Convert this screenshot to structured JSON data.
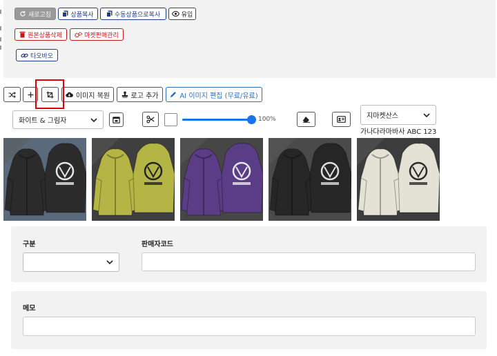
{
  "top_buttons": {
    "refresh": "새로고침",
    "copy_product": "상품복사",
    "manual_copy": "수동상품으로복사",
    "inflow": "유입",
    "delete_original": "원본상품삭제",
    "market_manage": "마켓판매관리",
    "taobao": "타오바오"
  },
  "toolbar": {
    "restore_image": "이미지 복원",
    "add_logo": "로고 추가",
    "ai_edit": "AI 이미지 편집 (무료/유료)"
  },
  "controls": {
    "background_select": "화이트 & 그림자",
    "opacity_percent": "100%",
    "opacity_value": 100,
    "font_select": "지마켓산스",
    "font_preview": "가나다라마바사 ABC 123"
  },
  "thumbnails": [
    {
      "name": "black-jacket-street",
      "body": "#2b2b2b",
      "bg": "#5a6a7a",
      "print": "#e8e8e8"
    },
    {
      "name": "olive-jacket",
      "body": "#b5b545",
      "bg": "#3f3f3f",
      "print": "#222222"
    },
    {
      "name": "purple-jacket",
      "body": "#5b3c86",
      "bg": "#464646",
      "print": "#e8e8e8"
    },
    {
      "name": "black-jacket",
      "body": "#262626",
      "bg": "#4a4a4a",
      "print": "#e0e0e0"
    },
    {
      "name": "cream-jacket",
      "body": "#e4e2d4",
      "bg": "#3c3c3c",
      "print": "#2a2a2a"
    }
  ],
  "form": {
    "category_label": "구분",
    "category_value": "",
    "seller_code_label": "판매자코드",
    "seller_code_value": "",
    "memo_label": "메모",
    "memo_value": ""
  },
  "colors": {
    "primary": "#1f3d8f",
    "danger": "#c81818",
    "accent": "#1a73e8",
    "highlight": "#e00000"
  }
}
